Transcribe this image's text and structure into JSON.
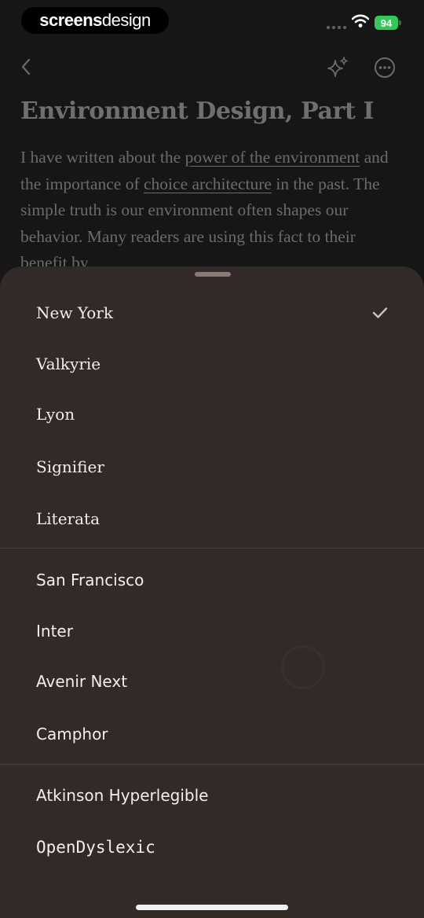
{
  "status_bar": {
    "brand_bold": "screens",
    "brand_light": "design",
    "battery": "94"
  },
  "nav": {
    "back_icon": "chevron-left-icon",
    "sparkle_icon": "sparkles-icon",
    "more_icon": "more-horizontal-circle-icon"
  },
  "article": {
    "title": "Environment Design, Part I",
    "body": {
      "t1": "I have written about the ",
      "l1": "power of the environment",
      "t2": " and the importance of ",
      "l2": "choice architecture",
      "t3": " in the past. The simple truth is our environment often shapes our behavior. Many readers are using this fact to their benefit by"
    }
  },
  "font_sheet": {
    "selected": "New York",
    "groups": [
      [
        "New York",
        "Valkyrie",
        "Lyon",
        "Signifier",
        "Literata"
      ],
      [
        "San Francisco",
        "Inter",
        "Avenir Next",
        "Camphor"
      ],
      [
        "Atkinson Hyperlegible",
        "OpenDyslexic"
      ]
    ]
  },
  "colors": {
    "background": "#161616",
    "sheet": "#322a27",
    "battery": "#34c759",
    "text_primary": "#f2efec"
  }
}
